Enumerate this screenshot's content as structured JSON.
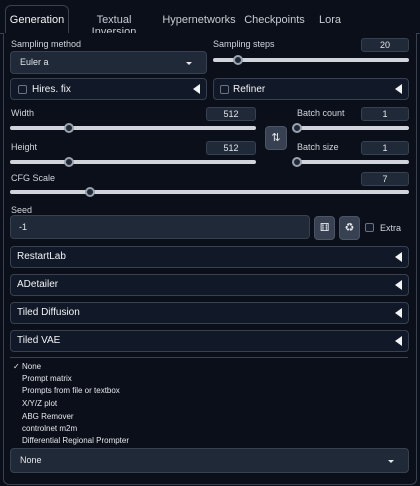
{
  "tabs": [
    "Generation",
    "Textual Inversion",
    "Hypernetworks",
    "Checkpoints",
    "Lora"
  ],
  "sampling": {
    "method_label": "Sampling method",
    "method_value": "Euler a",
    "steps_label": "Sampling steps",
    "steps_value": "20"
  },
  "hires": {
    "label": "Hires. fix"
  },
  "refiner": {
    "label": "Refiner"
  },
  "width": {
    "label": "Width",
    "value": "512"
  },
  "height": {
    "label": "Height",
    "value": "512"
  },
  "batch_count": {
    "label": "Batch count",
    "value": "1"
  },
  "batch_size": {
    "label": "Batch size",
    "value": "1"
  },
  "cfg": {
    "label": "CFG Scale",
    "value": "7"
  },
  "seed": {
    "label": "Seed",
    "value": "-1",
    "extra_label": "Extra"
  },
  "swap_icon": "swap-icon",
  "dice_icon": "dice-icon",
  "recycle_icon": "recycle-icon",
  "accordions": [
    "RestartLab",
    "ADetailer",
    "Tiled Diffusion",
    "Tiled VAE"
  ],
  "script_list": {
    "selected_mark": "✓",
    "items": [
      "None",
      "Prompt matrix",
      "Prompts from file or textbox",
      "X/Y/Z plot",
      "ABG Remover",
      "controlnet m2m",
      "Differential Regional Prompter"
    ]
  },
  "script_dropdown": {
    "value": "None"
  },
  "colors": {
    "background": "#0b0f19",
    "input": "#1f2937",
    "border": "#374151"
  },
  "slider_levels": {
    "steps": 0.13,
    "width": 0.24,
    "height": 0.24,
    "batch_count": 0.0,
    "batch_size": 0.0,
    "cfg": 0.2
  }
}
